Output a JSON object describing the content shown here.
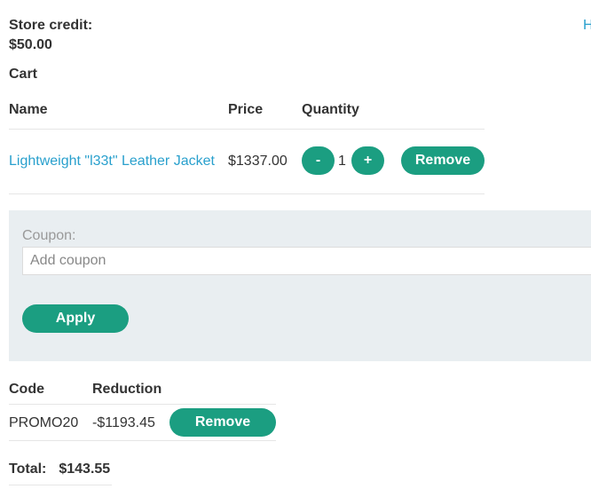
{
  "store_credit": {
    "label": "Store credit:",
    "value": "$50.00"
  },
  "top_link": {
    "label": "H"
  },
  "cart": {
    "title": "Cart",
    "columns": {
      "name": "Name",
      "price": "Price",
      "quantity": "Quantity"
    },
    "items": [
      {
        "name": "Lightweight \"l33t\" Leather Jacket",
        "price": "$1337.00",
        "quantity": "1",
        "decrement_label": "-",
        "increment_label": "+",
        "remove_label": "Remove"
      }
    ]
  },
  "coupon": {
    "label": "Coupon:",
    "placeholder": "Add coupon",
    "value": "",
    "apply_label": "Apply"
  },
  "codes": {
    "columns": {
      "code": "Code",
      "reduction": "Reduction"
    },
    "items": [
      {
        "code": "PROMO20",
        "reduction": "-$1193.45",
        "remove_label": "Remove"
      }
    ]
  },
  "total": {
    "label": "Total:",
    "value": "$143.55"
  },
  "colors": {
    "accent": "#1b9e81",
    "link": "#29a0cd",
    "panel_background": "#e9eef1",
    "text": "#333333"
  }
}
